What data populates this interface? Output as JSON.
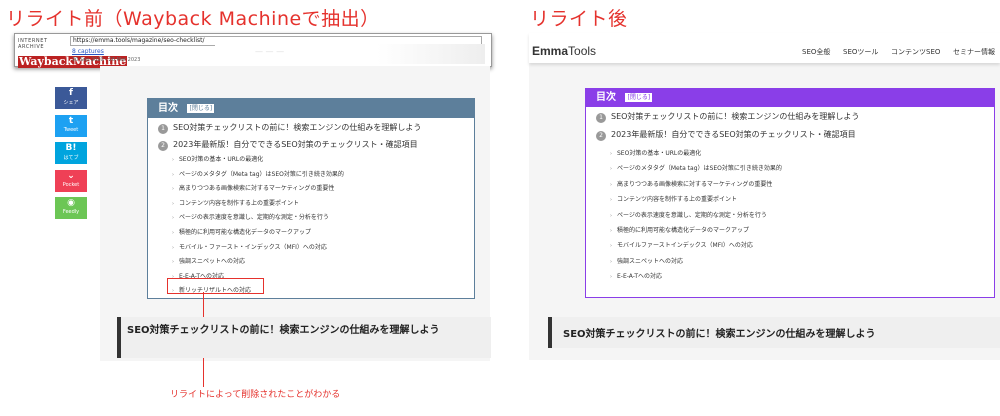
{
  "left": {
    "heading": "リライト前（Wayback Machineで抽出）",
    "wayback": {
      "logo_top": "INTERNET ARCHIVE",
      "logo_main": "WaybackMachine",
      "url": "https://emma.tools/magazine/seo-checklist/",
      "captures": "8 captures",
      "date_range": "30 Sep 2020 - 26 Mar 2023"
    },
    "share": [
      {
        "icon": "f",
        "label": "シェア",
        "color": "#3b5998"
      },
      {
        "icon": "t",
        "label": "Tweet",
        "color": "#1da1f2"
      },
      {
        "icon": "B!",
        "label": "はてブ",
        "color": "#00a4de"
      },
      {
        "icon": "⌄",
        "label": "Pocket",
        "color": "#ef4056"
      },
      {
        "icon": "◉",
        "label": "Feedly",
        "color": "#6cc655"
      }
    ],
    "toc": {
      "title": "目次",
      "close": "[閉じる]",
      "items": [
        {
          "num": "1",
          "text": "SEO対策チェックリストの前に！検索エンジンの仕組みを理解しよう"
        },
        {
          "num": "2",
          "text": "2023年最新版！自分でできるSEO対策のチェックリスト・確認項目"
        }
      ],
      "subitems": [
        "SEO対策の基本・URLの最適化",
        "ページのメタタグ（Meta tag）はSEO対策に引き続き効果的",
        "高まりつつある画像検索に対するマーケティングの重要性",
        "コンテンツ内容を制作する上の重要ポイント",
        "ページの表示速度を意識し、定期的な測定・分析を行う",
        "積極的に利用可能な構造化データのマークアップ",
        "モバイル・ファースト・インデックス（MFI）への対応",
        "強調スニペットへの対応",
        "E-E-A-Tへの対応",
        "新リッチリザルトへの対応"
      ]
    },
    "section_title": "SEO対策チェックリストの前に！検索エンジンの仕組みを理解しよう",
    "annotation": "リライトによって削除されたことがわかる"
  },
  "right": {
    "heading": "リライト後",
    "logo_bold": "Emma",
    "logo_rest": "Tools",
    "nav": [
      "SEO全般",
      "SEOツール",
      "コンテンツSEO",
      "セミナー情報"
    ],
    "toc": {
      "title": "目次",
      "close": "[閉じる]",
      "items": [
        {
          "num": "1",
          "text": "SEO対策チェックリストの前に！検索エンジンの仕組みを理解しよう"
        },
        {
          "num": "2",
          "text": "2023年最新版！自分でできるSEO対策のチェックリスト・確認項目"
        }
      ],
      "subitems": [
        "SEO対策の基本・URLの最適化",
        "ページのメタタグ（Meta tag）はSEO対策に引き続き効果的",
        "高まりつつある画像検索に対するマーケティングの重要性",
        "コンテンツ内容を制作する上の重要ポイント",
        "ページの表示速度を意識し、定期的な測定・分析を行う",
        "積極的に利用可能な構造化データのマークアップ",
        "モバイルファーストインデックス（MFI）への対応",
        "強調スニペットへの対応",
        "E-E-A-Tへの対応"
      ]
    },
    "section_title": "SEO対策チェックリストの前に！検索エンジンの仕組みを理解しよう"
  },
  "colors": {
    "annotation_red": "#e5322d",
    "toc_before": "#5d7f9b",
    "toc_after": "#8a3ee8"
  }
}
